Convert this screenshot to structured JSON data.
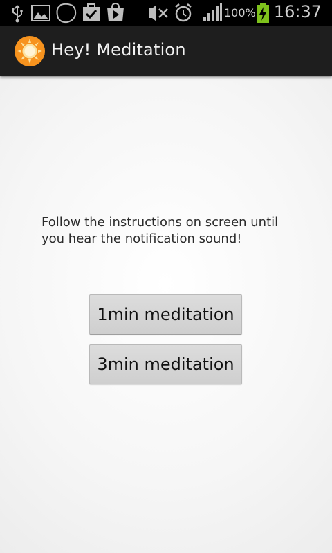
{
  "status_bar": {
    "icons": [
      "usb-icon",
      "gallery-icon",
      "chat-bubble-icon",
      "task-check-icon",
      "play-store-icon",
      "mute-icon",
      "alarm-icon",
      "signal-icon",
      "battery-charging-icon"
    ],
    "battery_percent": "100%",
    "time": "16:37",
    "battery_color": "#7ec21c"
  },
  "action_bar": {
    "title": "Hey! Meditation",
    "icon": "sun-icon",
    "icon_color": "#f7931e"
  },
  "main": {
    "instruction": "Follow the instructions on screen until you hear the notification sound!",
    "buttons": [
      {
        "label": "1min meditation"
      },
      {
        "label": "3min meditation"
      }
    ]
  }
}
